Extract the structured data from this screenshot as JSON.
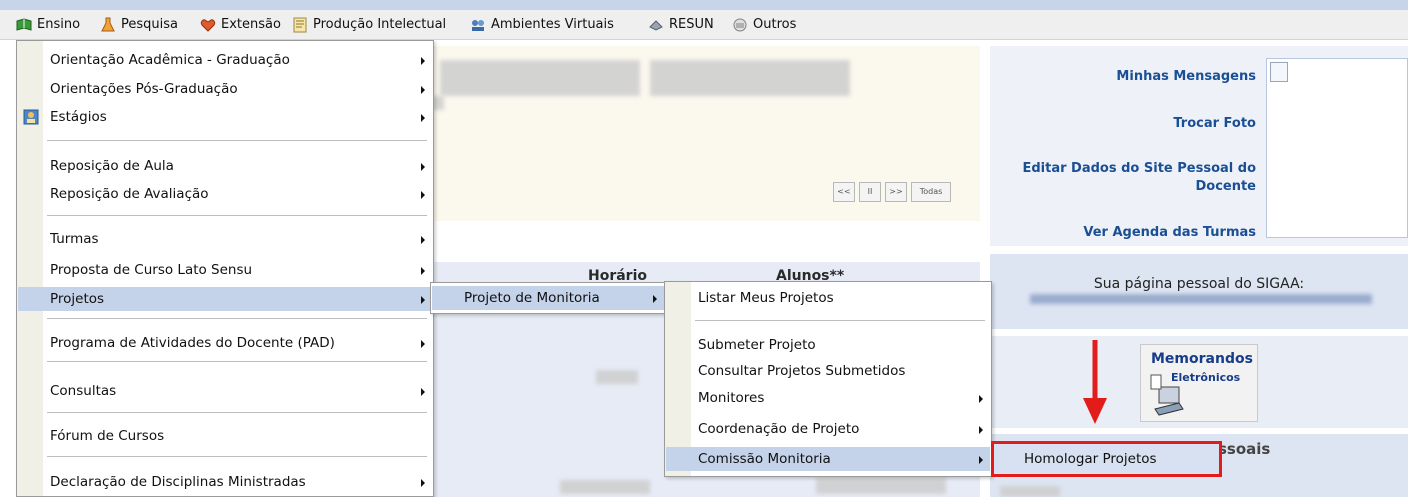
{
  "colors": {
    "accent": "#c4d3ea",
    "link": "#1b4f94",
    "highlight_border": "#e21b1b",
    "arrow": "#e21b1b"
  },
  "menubar": [
    {
      "label": "Ensino",
      "icon": "ensino-icon"
    },
    {
      "label": "Pesquisa",
      "icon": "pesquisa-icon"
    },
    {
      "label": "Extensão",
      "icon": "extensao-icon"
    },
    {
      "label": "Produção Intelectual",
      "icon": "producao-icon"
    },
    {
      "label": "Ambientes Virtuais",
      "icon": "ambientes-icon"
    },
    {
      "label": "RESUN",
      "icon": "resun-icon"
    },
    {
      "label": "Outros",
      "icon": "outros-icon"
    }
  ],
  "ensino_menu": [
    {
      "label": "Orientação Acadêmica - Graduação",
      "submenu": true
    },
    {
      "label": "Orientações Pós-Graduação",
      "submenu": true
    },
    {
      "label": "Estágios",
      "submenu": true,
      "icon": "estagios-icon"
    },
    {
      "label": "Reposição de Aula",
      "submenu": true
    },
    {
      "label": "Reposição de Avaliação",
      "submenu": true
    },
    {
      "label": "Turmas",
      "submenu": true
    },
    {
      "label": "Proposta de Curso Lato Sensu",
      "submenu": true
    },
    {
      "label": "Projetos",
      "submenu": true,
      "active": true
    },
    {
      "label": "Programa de Atividades do Docente (PAD)",
      "submenu": true
    },
    {
      "label": "Consultas",
      "submenu": true
    },
    {
      "label": "Fórum de Cursos",
      "submenu": false
    },
    {
      "label": "Declaração de Disciplinas Ministradas",
      "submenu": true
    }
  ],
  "projetos_menu": [
    {
      "label": "Projeto de Monitoria",
      "submenu": true,
      "active": true
    }
  ],
  "monitoria_menu": [
    {
      "label": "Listar Meus Projetos",
      "submenu": false
    },
    {
      "label": "Submeter Projeto",
      "submenu": false
    },
    {
      "label": "Consultar Projetos Submetidos",
      "submenu": false
    },
    {
      "label": "Monitores",
      "submenu": true
    },
    {
      "label": "Coordenação de Projeto",
      "submenu": true
    },
    {
      "label": "Comissão Monitoria",
      "submenu": true,
      "active": true
    }
  ],
  "comissao_menu": [
    {
      "label": "Homologar Projetos"
    }
  ],
  "nav_buttons": [
    "<<",
    "II",
    ">>",
    "Todas"
  ],
  "table_headers": {
    "horario": "Horário",
    "alunos": "Alunos**"
  },
  "sidebar": {
    "minhas_mensagens": "Minhas Mensagens",
    "trocar_foto": "Trocar Foto",
    "editar_dados": "Editar Dados do Site Pessoal do Docente",
    "ver_agenda": "Ver Agenda das Turmas",
    "pagina_pessoal": "Sua página pessoal do SIGAA:",
    "memo_title": "Memorandos",
    "memo_sub": "Eletrônicos",
    "pessoais": "ssoais"
  }
}
